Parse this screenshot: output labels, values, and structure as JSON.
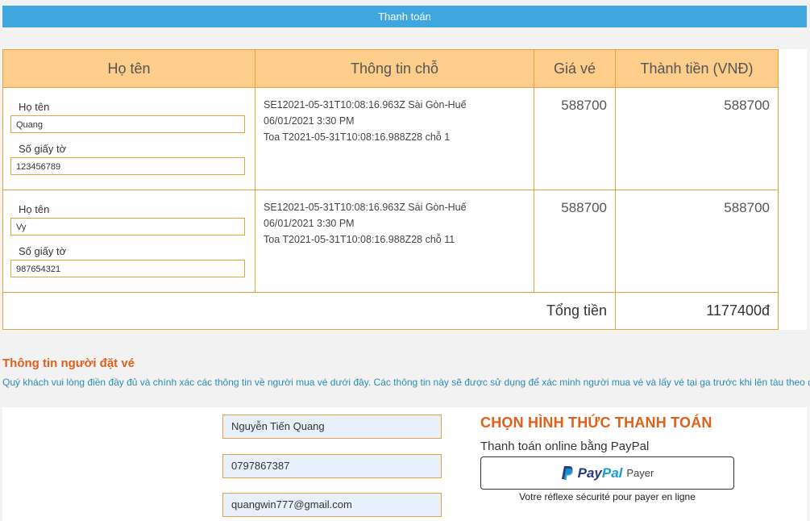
{
  "header": {
    "title": "Thanh toán"
  },
  "table": {
    "headers": [
      "Họ tên",
      "Thông tin chỗ",
      "Giá vé",
      "Thành tiền (VNĐ)"
    ],
    "rows": [
      {
        "name_label": "Họ tên",
        "name_value": "Quang",
        "id_label": "Số giấy tờ",
        "id_value": "123456789",
        "info_line1": "SE12021-05-31T10:08:16.963Z Sài Gòn-Huế",
        "info_line2": "06/01/2021 3:30 PM",
        "info_line3": "Toa T2021-05-31T10:08:16.988Z28 chỗ 1",
        "price": "588700",
        "subtotal": "588700"
      },
      {
        "name_label": "Họ tên",
        "name_value": "Vy",
        "id_label": "Số giấy tờ",
        "id_value": "987654321",
        "info_line1": "SE12021-05-31T10:08:16.963Z Sài Gòn-Huế",
        "info_line2": "06/01/2021 3:30 PM",
        "info_line3": "Toa T2021-05-31T10:08:16.988Z28 chỗ 11",
        "price": "588700",
        "subtotal": "588700"
      }
    ],
    "total_label": "Tổng tiền",
    "total_value": "1177400đ"
  },
  "booker": {
    "title": "Thông tin người đặt vé",
    "description": "Quý khách vui lòng điền đầy đủ và chính xác các thông tin về người mua vé dưới đây. Các thông tin này sẽ được sử dụng để xác minh người mua vé và lấy vé tại ga trước khi lên tàu theo đúng các quy định của Tổng công ty Đường sắt Việt Nam.",
    "name": "Nguyễn Tiến Quang",
    "phone": "0797867387",
    "email": "quangwin777@gmail.com"
  },
  "payment": {
    "title": "CHỌN HÌNH THỨC THANH TOÁN",
    "subtitle": "Thanh toán online bằng PayPal",
    "paypal_pay": "Pay",
    "paypal_pal": "Pal",
    "paypal_payer": "Payer",
    "tagline": "Votre réflexe sécurité pour payer en ligne"
  },
  "colors": {
    "header_bar": "#3fa6e0",
    "table_header": "#fccd8b",
    "border": "#e6a23e",
    "section_title": "#e0601a",
    "description": "#2a8db5"
  }
}
